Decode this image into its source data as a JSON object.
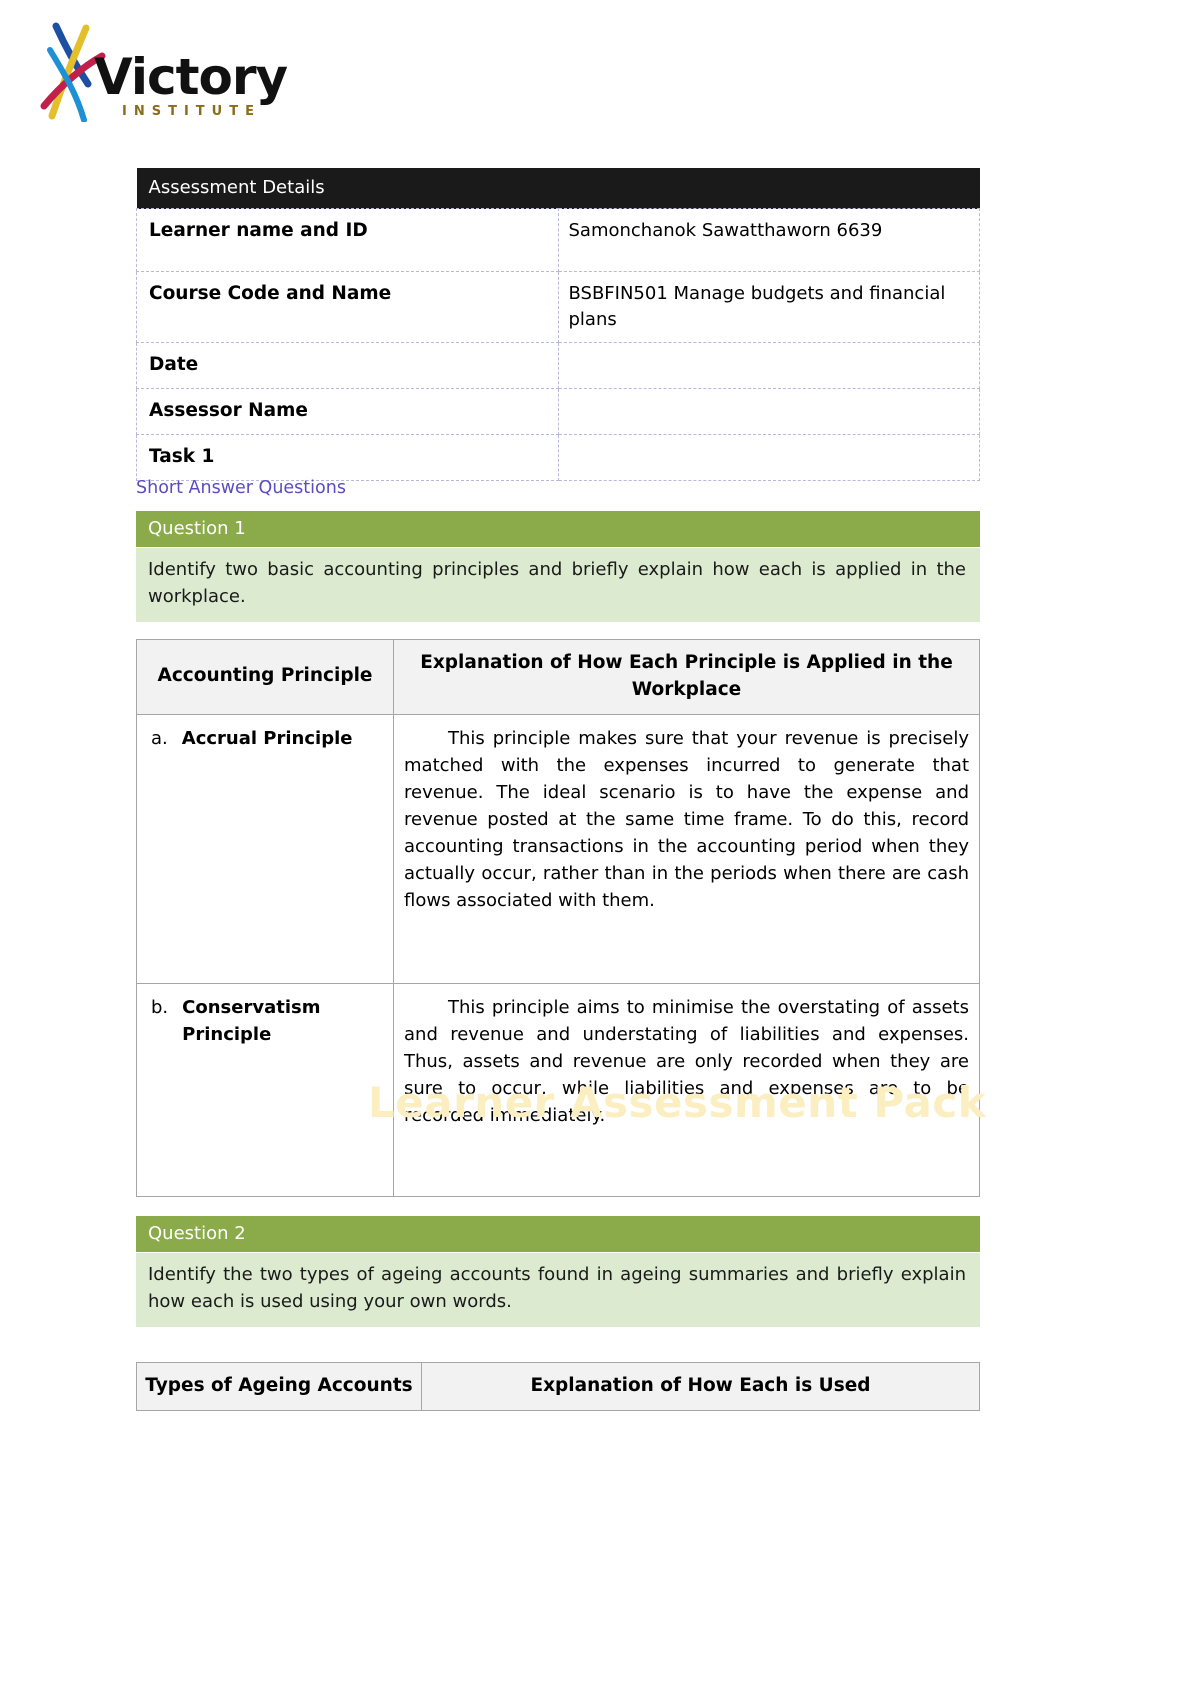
{
  "logo": {
    "brand": "Victory",
    "subtitle": "INSTITUTE",
    "mark_colors": [
      "#1f4fa3",
      "#e3bf2a",
      "#c0204a",
      "#1f8fd6"
    ]
  },
  "watermark": {
    "text": "Learner Assessment Pack",
    "color": "#fbeec0"
  },
  "details": {
    "title": "Assessment Details",
    "rows": [
      {
        "label": "Learner name and ID",
        "value": "Samonchanok Sawatthaworn 6639"
      },
      {
        "label": "Course Code and Name",
        "value": "BSBFIN501 Manage budgets and financial plans"
      },
      {
        "label": "Date",
        "value": ""
      },
      {
        "label": "Assessor Name",
        "value": ""
      },
      {
        "label": "Task 1",
        "value": ""
      }
    ]
  },
  "section": {
    "short_answer_label": "Short Answer Questions"
  },
  "question1": {
    "header": "Question 1",
    "prompt": "Identify two basic accounting principles and briefly explain how each is applied in the workplace.",
    "table": {
      "col1_header": "Accounting Principle",
      "col2_header": "Explanation of How Each Principle is Applied in the Workplace",
      "rows": [
        {
          "letter": "a.",
          "name": "Accrual Principle",
          "explanation": "This principle makes sure that your revenue is precisely matched with the expenses incurred to generate that revenue. The ideal scenario is to have the expense and revenue posted at the same time frame. To do this, record accounting transactions in the accounting period when they actually occur, rather than in the periods when there are cash flows associated with them."
        },
        {
          "letter": "b.",
          "name": "Conservatism Principle",
          "explanation": "This principle aims to minimise the overstating of assets and revenue and understating of liabilities and expenses. Thus, assets and revenue are only recorded when they are sure to occur, while liabilities and expenses are to be recorded immediately."
        }
      ]
    }
  },
  "question2": {
    "header": "Question 2",
    "prompt": "Identify the two types of ageing accounts found in ageing summaries and briefly explain how each is used using your own words.",
    "table": {
      "col1_header": "Types of Ageing Accounts",
      "col2_header": "Explanation of How Each is Used"
    }
  },
  "colors": {
    "question_header_green": "#8bab4a",
    "question_body_green": "#dcead0",
    "details_header_black": "#1a1a1a",
    "link_purple": "#5b4bbf",
    "table_header_grey": "#f2f2f2"
  }
}
